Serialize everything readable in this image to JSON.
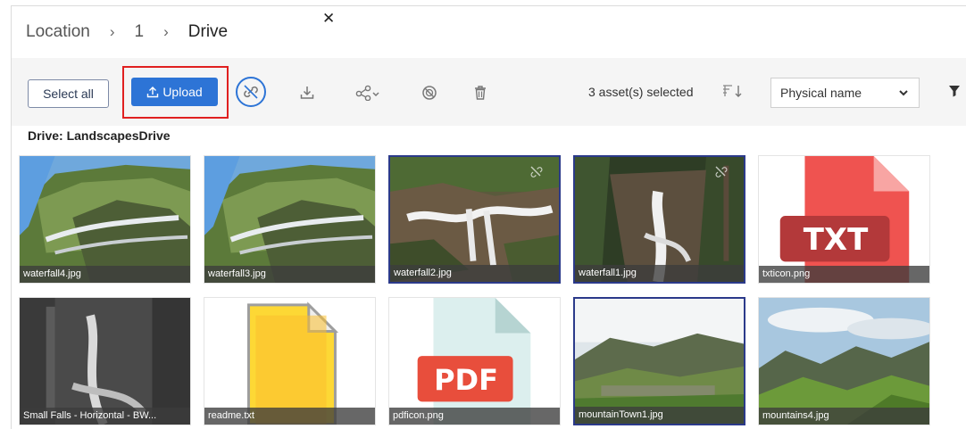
{
  "breadcrumb": {
    "items": [
      "Location",
      "1",
      "Drive"
    ],
    "separator": "›",
    "close_icon": "close-icon"
  },
  "toolbar": {
    "select_all_label": "Select all",
    "upload_label": "Upload",
    "selected_count": "3 asset(s) selected",
    "sort_value": "Physical name",
    "icons": [
      "upload-icon",
      "unlink-icon",
      "download-icon",
      "share-icon",
      "block-icon",
      "trash-icon",
      "sort-order-icon",
      "chevron-down-icon",
      "filter-icon"
    ]
  },
  "drive": {
    "prefix": "Drive:",
    "name": "LandscapesDrive"
  },
  "assets": [
    {
      "name": "waterfall4.jpg",
      "selected": false,
      "kind": "waterfall-cliff"
    },
    {
      "name": "waterfall3.jpg",
      "selected": false,
      "kind": "waterfall-cliff"
    },
    {
      "name": "waterfall2.jpg",
      "selected": true,
      "kind": "waterfall-stream"
    },
    {
      "name": "waterfall1.jpg",
      "selected": true,
      "kind": "waterfall-forest"
    },
    {
      "name": "txticon.png",
      "selected": false,
      "kind": "txt-icon",
      "badge": "TXT"
    },
    {
      "name": "Small Falls - Horizontal - BW...",
      "selected": false,
      "kind": "bw-falls"
    },
    {
      "name": "readme.txt",
      "selected": false,
      "kind": "file-icon"
    },
    {
      "name": "pdficon.png",
      "selected": false,
      "kind": "pdf-icon",
      "badge": "PDF"
    },
    {
      "name": "mountainTown1.jpg",
      "selected": true,
      "kind": "mountain-town"
    },
    {
      "name": "mountains4.jpg",
      "selected": false,
      "kind": "mountains"
    }
  ],
  "colors": {
    "accent": "#2d74d6",
    "selected_border": "#2b3a8a",
    "highlight": "#e02020"
  }
}
